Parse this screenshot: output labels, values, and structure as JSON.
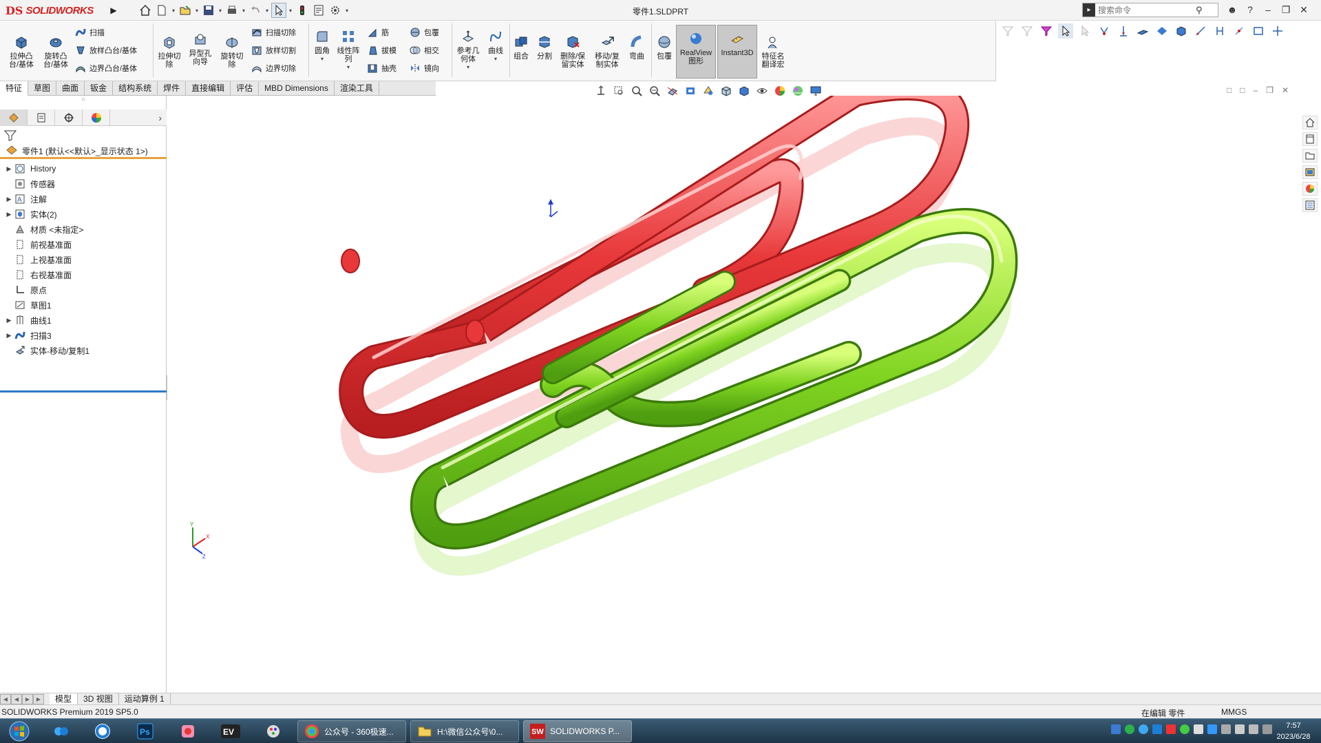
{
  "app": {
    "logo_mark": "DS",
    "logo_text": "SOLIDWORKS",
    "window_title": "零件1.SLDPRT",
    "search_placeholder": "搜索命令"
  },
  "ribbon": {
    "extrude_boss": "拉伸凸台/基体",
    "revolve_boss": "旋转凸台/基体",
    "sweep": "扫描",
    "loft_boss": "放样凸台/基体",
    "boundary_boss": "边界凸台/基体",
    "extrude_cut": "拉伸切除",
    "hole_wizard": "异型孔向导",
    "revolve_cut": "旋转切除",
    "swept_cut": "扫描切除",
    "lofted_cut": "放样切割",
    "boundary_cut": "边界切除",
    "fillet": "圆角",
    "linear_pattern": "线性阵列",
    "rib": "筋",
    "draft": "拔模",
    "shell": "抽壳",
    "wrap": "包覆",
    "intersect": "相交",
    "mirror": "镜向",
    "reference_geometry": "参考几何体",
    "curves": "曲线",
    "combine": "组合",
    "split": "分割",
    "delete_keep_body": "删除/保留实体",
    "move_copy_body": "移动/复制实体",
    "flex": "弯曲",
    "wrap2": "包覆",
    "realview": "RealView图形",
    "instant3d": "Instant3D",
    "feature_translate": "特征名翻译宏"
  },
  "tabs": [
    "特征",
    "草图",
    "曲面",
    "钣金",
    "结构系统",
    "焊件",
    "直接编辑",
    "评估",
    "MBD Dimensions",
    "渲染工具"
  ],
  "feature_tree": {
    "root": "零件1 (默认<<默认>_显示状态 1>)",
    "items": [
      {
        "label": "History",
        "expandable": true
      },
      {
        "label": "传感器",
        "expandable": false
      },
      {
        "label": "注解",
        "expandable": true
      },
      {
        "label": "实体(2)",
        "expandable": true
      },
      {
        "label": "材质 <未指定>",
        "expandable": false
      },
      {
        "label": "前视基准面",
        "expandable": false
      },
      {
        "label": "上视基准面",
        "expandable": false
      },
      {
        "label": "右视基准面",
        "expandable": false
      },
      {
        "label": "原点",
        "expandable": false
      },
      {
        "label": "草图1",
        "expandable": false
      },
      {
        "label": "曲线1",
        "expandable": true
      },
      {
        "label": "扫描3",
        "expandable": true
      },
      {
        "label": "实体-移动/复制1",
        "expandable": false
      }
    ]
  },
  "bottom_tabs": [
    "模型",
    "3D 视图",
    "运动算例 1"
  ],
  "status": {
    "product": "SOLIDWORKS Premium 2019 SP5.0",
    "editing": "在编辑 零件",
    "units": "MMGS"
  },
  "taskbar": {
    "tasks": [
      "公众号 - 360极速...",
      "H:\\微信公众号\\0...",
      "SOLIDWORKS P..."
    ],
    "time": "7:57",
    "date": "2023/6/28"
  },
  "colors": {
    "clip_red": "#e8383a",
    "clip_green": "#7fd320",
    "brand": "#d42020"
  }
}
